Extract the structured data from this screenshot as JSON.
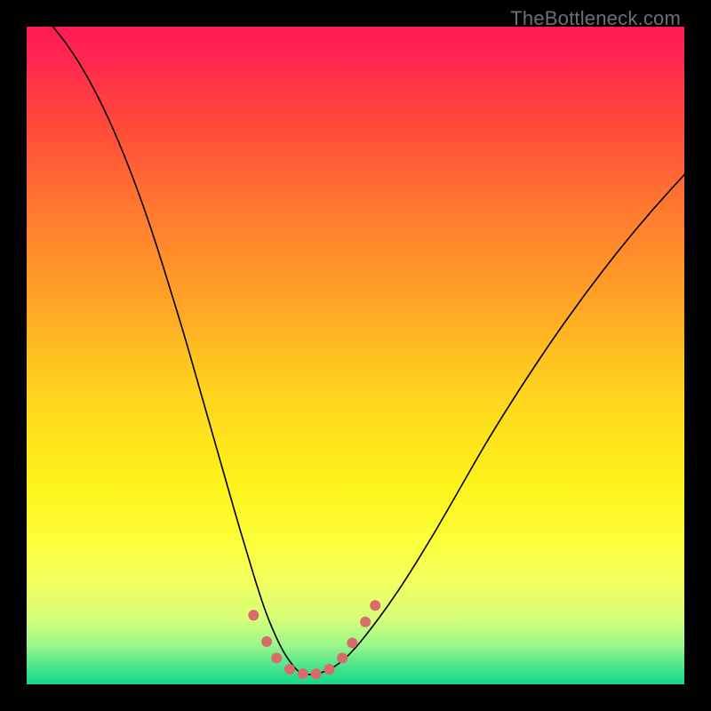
{
  "watermark": "TheBottleneck.com",
  "chart_data": {
    "type": "line",
    "title": "",
    "xlabel": "",
    "ylabel": "",
    "xlim": [
      0,
      100
    ],
    "ylim": [
      0,
      100
    ],
    "grid": false,
    "annotations": [],
    "background_gradient": {
      "direction": "vertical",
      "stops": [
        {
          "pos": 0.0,
          "color": "#ff1a55"
        },
        {
          "pos": 0.05,
          "color": "#ff2850"
        },
        {
          "pos": 0.15,
          "color": "#ff4a3a"
        },
        {
          "pos": 0.28,
          "color": "#ff7a2f"
        },
        {
          "pos": 0.42,
          "color": "#ffa426"
        },
        {
          "pos": 0.55,
          "color": "#ffd21e"
        },
        {
          "pos": 0.7,
          "color": "#fff41a"
        },
        {
          "pos": 0.78,
          "color": "#fcff3a"
        },
        {
          "pos": 0.84,
          "color": "#f4ff5e"
        },
        {
          "pos": 0.9,
          "color": "#d6ff78"
        },
        {
          "pos": 0.94,
          "color": "#9cf78a"
        },
        {
          "pos": 0.97,
          "color": "#54e58e"
        },
        {
          "pos": 1.0,
          "color": "#14d886"
        }
      ]
    },
    "series": [
      {
        "name": "bottleneck-curve",
        "color": "#000000",
        "stroke_width": 1.6,
        "x": [
          4,
          6,
          8,
          10,
          12,
          14,
          16,
          18,
          20,
          22,
          24,
          26,
          28,
          30,
          32,
          33.5,
          35,
          36.5,
          38,
          39,
          40,
          41,
          42,
          44,
          46,
          48,
          50,
          52,
          55,
          58,
          62,
          66,
          70,
          75,
          80,
          85,
          90,
          95,
          100
        ],
        "y": [
          100,
          97.5,
          94.5,
          91,
          87,
          82.5,
          77.5,
          72,
          66,
          59.5,
          53,
          46,
          39,
          32,
          25,
          20,
          15,
          10.5,
          7,
          5,
          3.5,
          2.2,
          1.5,
          1.5,
          2.2,
          3.5,
          5.5,
          8,
          12,
          16.5,
          23,
          30,
          37,
          45,
          52.5,
          59.5,
          66,
          72,
          77.5
        ]
      }
    ],
    "markers": {
      "name": "highlight-points",
      "color": "#d96b6b",
      "radius": 6,
      "points": [
        {
          "x": 34.5,
          "y": 10.5
        },
        {
          "x": 36.5,
          "y": 6.5
        },
        {
          "x": 38.0,
          "y": 4.0
        },
        {
          "x": 40.0,
          "y": 2.3
        },
        {
          "x": 42.0,
          "y": 1.6
        },
        {
          "x": 44.0,
          "y": 1.6
        },
        {
          "x": 46.0,
          "y": 2.3
        },
        {
          "x": 48.0,
          "y": 4.0
        },
        {
          "x": 49.5,
          "y": 6.3
        },
        {
          "x": 51.5,
          "y": 9.5
        },
        {
          "x": 53.0,
          "y": 12.0
        }
      ]
    }
  }
}
